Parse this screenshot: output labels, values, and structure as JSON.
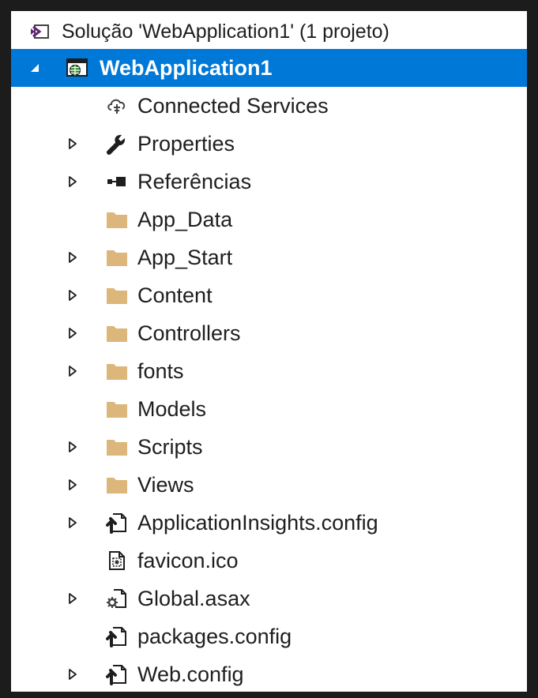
{
  "solution_explorer": {
    "solution_label": "Solução 'WebApplication1' (1 projeto)",
    "project": {
      "label": "WebApplication1",
      "state": "expanded",
      "selected": true,
      "icon": "web-project-icon",
      "children": [
        {
          "label": "Connected Services",
          "icon": "connected-services-icon",
          "expandable": false
        },
        {
          "label": "Properties",
          "icon": "wrench-icon",
          "expandable": true
        },
        {
          "label": "Referências",
          "icon": "references-icon",
          "expandable": true
        },
        {
          "label": "App_Data",
          "icon": "folder-icon",
          "expandable": false
        },
        {
          "label": "App_Start",
          "icon": "folder-icon",
          "expandable": true
        },
        {
          "label": "Content",
          "icon": "folder-icon",
          "expandable": true
        },
        {
          "label": "Controllers",
          "icon": "folder-icon",
          "expandable": true
        },
        {
          "label": "fonts",
          "icon": "folder-icon",
          "expandable": true
        },
        {
          "label": "Models",
          "icon": "folder-icon",
          "expandable": false
        },
        {
          "label": "Scripts",
          "icon": "folder-icon",
          "expandable": true
        },
        {
          "label": "Views",
          "icon": "folder-icon",
          "expandable": true
        },
        {
          "label": "ApplicationInsights.config",
          "icon": "config-file-icon",
          "expandable": true
        },
        {
          "label": "favicon.ico",
          "icon": "ico-file-icon",
          "expandable": false
        },
        {
          "label": "Global.asax",
          "icon": "asax-file-icon",
          "expandable": true
        },
        {
          "label": "packages.config",
          "icon": "config-file-icon",
          "expandable": false
        },
        {
          "label": "Web.config",
          "icon": "config-file-icon",
          "expandable": true
        }
      ]
    }
  },
  "colors": {
    "selection": "#0078d7",
    "folder": "#dcb67a",
    "solution_icon": "#68217a",
    "text": "#1e1e1e"
  }
}
